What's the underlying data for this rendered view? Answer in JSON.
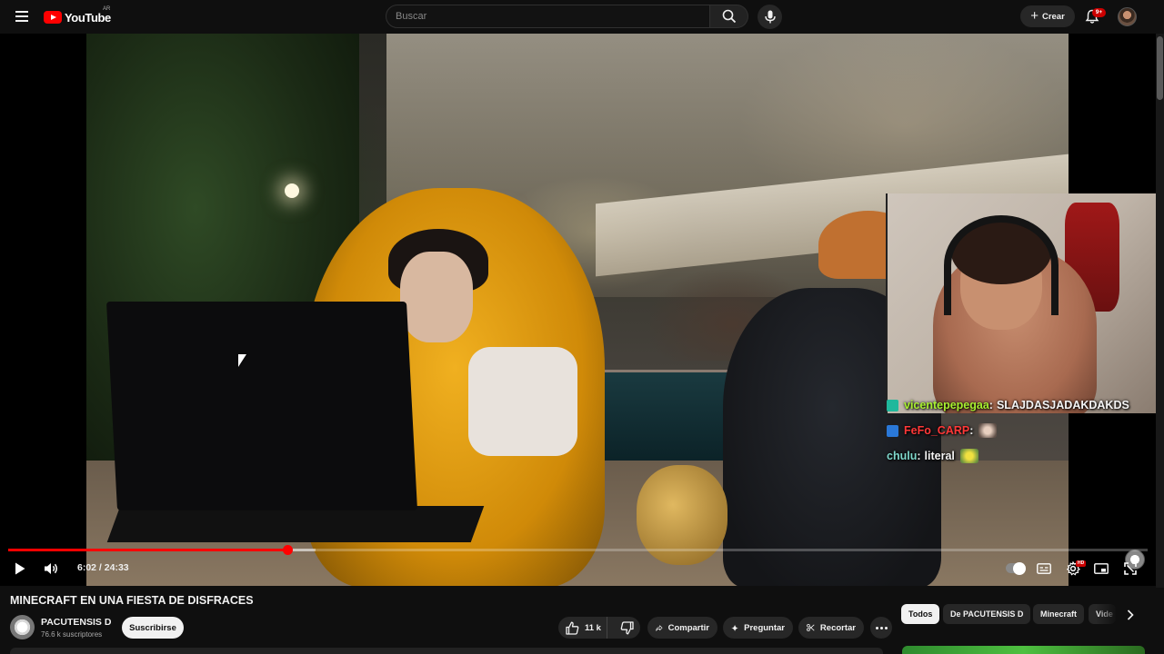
{
  "header": {
    "logo_text": "YouTube",
    "country_code": "AR",
    "search_placeholder": "Buscar",
    "create_label": "Crear",
    "notification_count": "9+"
  },
  "player": {
    "current_time": "6:02",
    "duration": "24:33",
    "time_display": "6:02 / 24:33",
    "progress_fraction": 0.245,
    "buffered_fraction": 0.27,
    "hd_badge": "HD"
  },
  "chat": [
    {
      "user": "vicentepepegaa",
      "separator": " :",
      "message": "SLAJDASJADAKDAKDS",
      "user_color": "#a8f030"
    },
    {
      "user": "FeFo_CARP",
      "separator": " :",
      "message": "",
      "user_color": "#ff3838"
    },
    {
      "user": "chulu",
      "separator": " :",
      "message": "literal",
      "user_color": "#7fd8cc"
    }
  ],
  "video": {
    "title": "MINECRAFT EN UNA FIESTA DE DISFRACES",
    "channel_name": "PACUTENSIS D",
    "subscribers": "76.6 k suscriptores",
    "subscribe_label": "Suscribirse",
    "likes": "11 k",
    "share_label": "Compartir",
    "ask_label": "Preguntar",
    "clip_label": "Recortar"
  },
  "chips": [
    "Todos",
    "De PACUTENSIS D",
    "Minecraft",
    "Vide"
  ],
  "colors": {
    "accent": "#ff0000",
    "background": "#0f0f0f",
    "pill": "#272727"
  }
}
